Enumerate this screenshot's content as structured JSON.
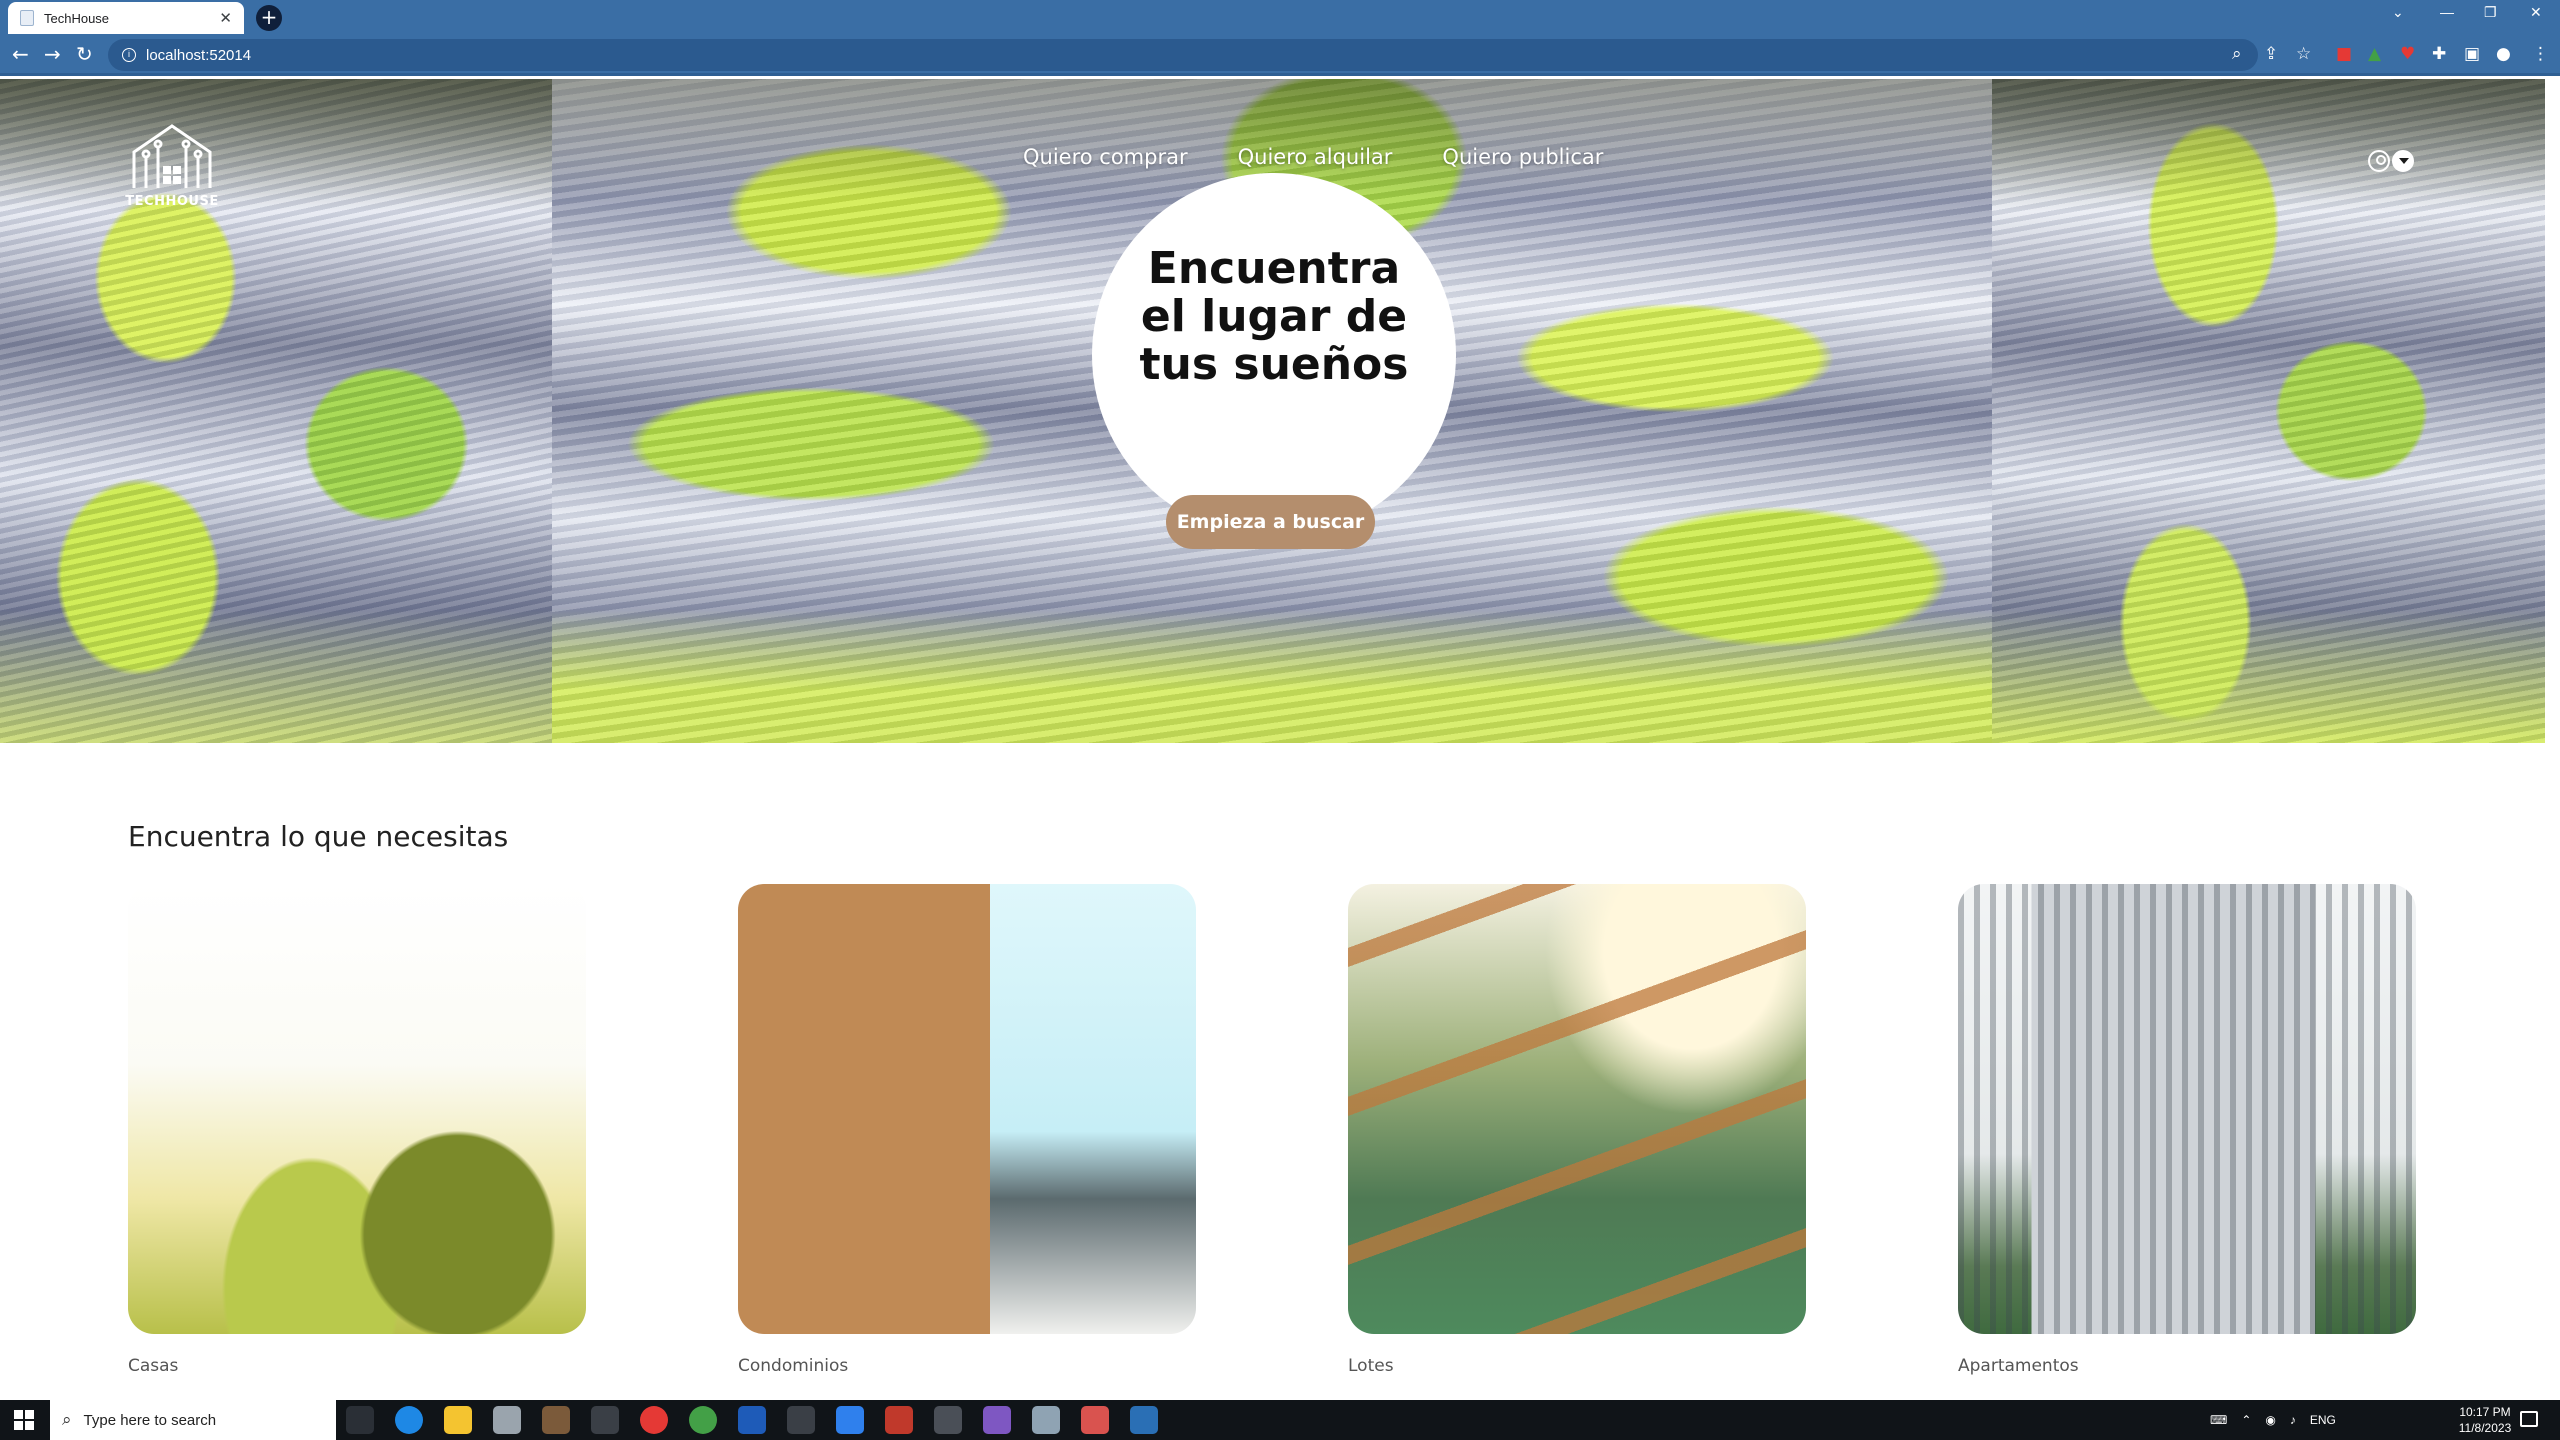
{
  "browser": {
    "tab_title": "TechHouse",
    "url": "localhost:52014",
    "new_tab_symbol": "+",
    "close_symbol": "✕"
  },
  "header": {
    "logo_text": "TECHHOUSE",
    "nav": [
      {
        "label": "Quiero comprar"
      },
      {
        "label": "Quiero alquilar"
      },
      {
        "label": "Quiero publicar"
      }
    ]
  },
  "hero": {
    "title_line1": "Encuentra",
    "title_line2": "el lugar de",
    "title_line3": "tus sueños",
    "cta_label": "Empieza a buscar",
    "cta_color": "#b48e6d"
  },
  "categories": {
    "title": "Encuentra lo que necesitas",
    "items": [
      {
        "label": "Casas"
      },
      {
        "label": "Condominios"
      },
      {
        "label": "Lotes"
      },
      {
        "label": "Apartamentos"
      }
    ]
  },
  "taskbar": {
    "search_placeholder": "Type here to search",
    "language": "ENG",
    "time": "10:17 PM",
    "date": "11/8/2023"
  }
}
